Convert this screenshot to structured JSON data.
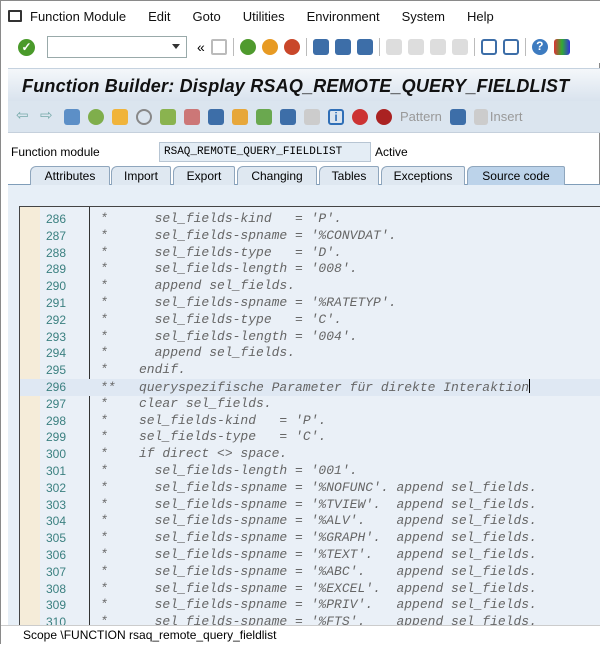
{
  "menu": [
    "Function Module",
    "Edit",
    "Goto",
    "Utilities",
    "Environment",
    "System",
    "Help"
  ],
  "title": "Function Builder: Display RSAQ_REMOTE_QUERY_FIELDLIST",
  "toolbar": {
    "pattern": "Pattern",
    "insert": "Insert"
  },
  "function_module": {
    "label": "Function module",
    "value": "RSAQ_REMOTE_QUERY_FIELDLIST",
    "status": "Active"
  },
  "tabs": [
    "Attributes",
    "Import",
    "Export",
    "Changing",
    "Tables",
    "Exceptions",
    "Source code"
  ],
  "active_tab": "Source code",
  "code": [
    {
      "n": "286",
      "t": "*      sel_fields-kind   = 'P'."
    },
    {
      "n": "287",
      "t": "*      sel_fields-spname = '%CONVDAT'."
    },
    {
      "n": "288",
      "t": "*      sel_fields-type   = 'D'."
    },
    {
      "n": "289",
      "t": "*      sel_fields-length = '008'."
    },
    {
      "n": "290",
      "t": "*      append sel_fields."
    },
    {
      "n": "291",
      "t": "*      sel_fields-spname = '%RATETYP'."
    },
    {
      "n": "292",
      "t": "*      sel_fields-type   = 'C'."
    },
    {
      "n": "293",
      "t": "*      sel_fields-length = '004'."
    },
    {
      "n": "294",
      "t": "*      append sel_fields."
    },
    {
      "n": "295",
      "t": "*    endif."
    },
    {
      "n": "296",
      "t": "**   queryspezifische Parameter für direkte Interaktion"
    },
    {
      "n": "297",
      "t": "*    clear sel_fields."
    },
    {
      "n": "298",
      "t": "*    sel_fields-kind   = 'P'."
    },
    {
      "n": "299",
      "t": "*    sel_fields-type   = 'C'."
    },
    {
      "n": "300",
      "t": "*    if direct <> space."
    },
    {
      "n": "301",
      "t": "*      sel_fields-length = '001'."
    },
    {
      "n": "302",
      "t": "*      sel_fields-spname = '%NOFUNC'. append sel_fields."
    },
    {
      "n": "303",
      "t": "*      sel_fields-spname = '%TVIEW'.  append sel_fields."
    },
    {
      "n": "304",
      "t": "*      sel_fields-spname = '%ALV'.    append sel_fields."
    },
    {
      "n": "305",
      "t": "*      sel_fields-spname = '%GRAPH'.  append sel_fields."
    },
    {
      "n": "306",
      "t": "*      sel_fields-spname = '%TEXT'.   append sel_fields."
    },
    {
      "n": "307",
      "t": "*      sel_fields-spname = '%ABC'.    append sel_fields."
    },
    {
      "n": "308",
      "t": "*      sel_fields-spname = '%EXCEL'.  append sel_fields."
    },
    {
      "n": "309",
      "t": "*      sel_fields-spname = '%PRIV'.   append sel_fields."
    },
    {
      "n": "310",
      "t": "*      sel_fields-spname = '%FTS'.    append sel_fields."
    }
  ],
  "status_bar": "Scope \\FUNCTION rsaq_remote_query_fieldlist"
}
